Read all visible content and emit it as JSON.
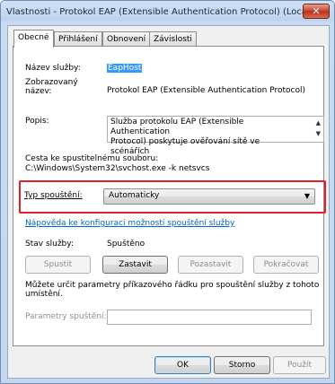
{
  "window": {
    "title": "Vlastnosti - Protokol EAP (Extensible Authentication Protocol) (Loca...",
    "close_glyph": "✕"
  },
  "tabs": [
    {
      "label": "Obecné",
      "active": true
    },
    {
      "label": "Přihlášení",
      "active": false
    },
    {
      "label": "Obnovení",
      "active": false
    },
    {
      "label": "Závislosti",
      "active": false
    }
  ],
  "general": {
    "service_name_label": "Název služby:",
    "service_name_value": "EapHost",
    "display_name_label_1": "Zobrazovaný",
    "display_name_label_2": "název:",
    "display_name_value": "Protokol EAP (Extensible Authentication Protocol)",
    "description_label": "Popis:",
    "description_line1": "Služba protokolu EAP (Extensible Authentication",
    "description_line2": "Protocol) poskytuje ověřování sítě ve scénářích",
    "path_label": "Cesta ke spustitelnému souboru:",
    "path_value": "C:\\Windows\\System32\\svchost.exe -k netsvcs",
    "startup_type_label": "Typ spouštění:",
    "startup_type_value": "Automaticky",
    "help_link": "Nápověda ke konfiguraci možností spouštění služby",
    "status_label": "Stav služby:",
    "status_value": "Spuštěno",
    "btn_start": "Spustit",
    "btn_stop": "Zastavit",
    "btn_pause": "Pozastavit",
    "btn_resume": "Pokračovat",
    "params_text_1": "Můžete určit parametry příkazového řádku pro spouštění služby z tohoto",
    "params_text_2": "umístění.",
    "params_label": "Parametry spuštění:",
    "params_value": ""
  },
  "footer": {
    "ok": "OK",
    "cancel": "Storno",
    "apply": "Použít"
  },
  "colors": {
    "highlight_box": "#e0202a",
    "selection": "#3399ff",
    "link": "#0066cc"
  },
  "icons": {
    "close": "close-icon",
    "scroll_up": "scroll-up-icon",
    "scroll_down": "scroll-down-icon",
    "dropdown": "chevron-down-icon"
  }
}
